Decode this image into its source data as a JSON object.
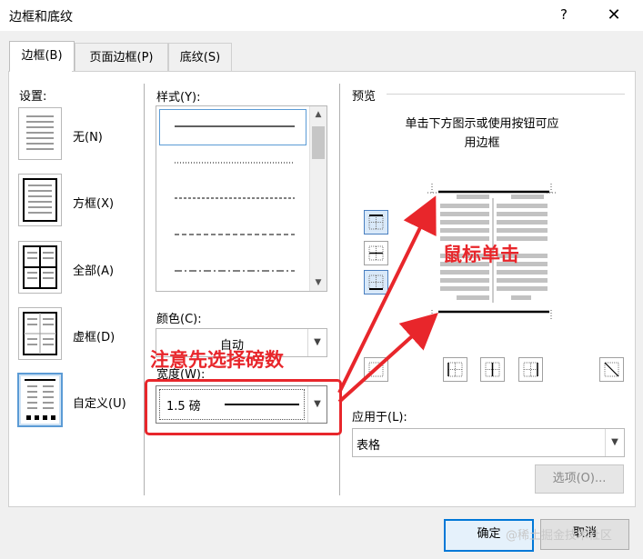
{
  "window": {
    "title": "边框和底纹",
    "help": "?",
    "close": "✕"
  },
  "tabs": [
    {
      "label": "边框(B)"
    },
    {
      "label": "页面边框(P)"
    },
    {
      "label": "底纹(S)"
    }
  ],
  "settings": {
    "heading": "设置:",
    "items": [
      {
        "label": "无(N)"
      },
      {
        "label": "方框(X)"
      },
      {
        "label": "全部(A)"
      },
      {
        "label": "虚框(D)"
      },
      {
        "label": "自定义(U)"
      }
    ]
  },
  "style": {
    "label": "样式(Y):",
    "scroll_up": "▲",
    "scroll_down": "▼"
  },
  "color": {
    "label": "颜色(C):",
    "value": "自动"
  },
  "width": {
    "label": "宽度(W):",
    "value": "1.5 磅"
  },
  "preview": {
    "heading": "预览",
    "hint_line1": "单击下方图示或使用按钮可应",
    "hint_line2": "用边框"
  },
  "apply_to": {
    "label": "应用于(L):",
    "value": "表格"
  },
  "buttons": {
    "options": "选项(O)...",
    "ok": "确定",
    "cancel": "取消"
  },
  "annotations": {
    "width_note": "注意先选择磅数",
    "click_note": "鼠标单击",
    "color": "#e8262b"
  },
  "watermark": "@稀土掘金技术社区"
}
